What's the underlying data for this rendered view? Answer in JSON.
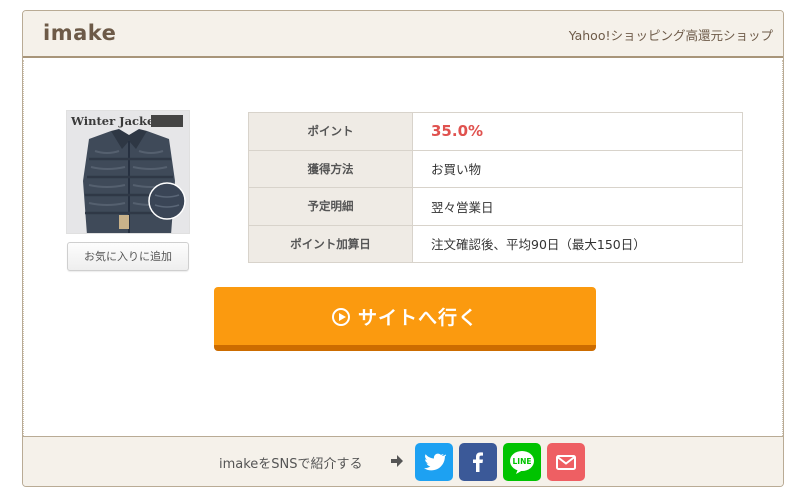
{
  "shop": {
    "name": "imake",
    "source": "Yahoo!ショッピング高還元ショップ"
  },
  "product": {
    "image_title": "Winter Jacket",
    "image_brand": "",
    "favorite_label": "お気に入りに追加"
  },
  "details": [
    {
      "key": "ポイント",
      "value": "35.0%"
    },
    {
      "key": "獲得方法",
      "value": "お買い物"
    },
    {
      "key": "予定明細",
      "value": "翌々営業日"
    },
    {
      "key": "ポイント加算日",
      "value": "注文確認後、平均90日（最大150日）"
    }
  ],
  "cta": {
    "label": "サイトへ行く",
    "icon": "play-circle-icon"
  },
  "share": {
    "text": "imakeをSNSで紹介する",
    "arrow_icon": "arrow-right-icon",
    "buttons": [
      {
        "name": "twitter",
        "icon": "twitter-icon",
        "color": "#1da1f2"
      },
      {
        "name": "facebook",
        "icon": "facebook-icon",
        "color": "#3b5998"
      },
      {
        "name": "line",
        "icon": "line-icon",
        "label": "LINE",
        "color": "#00c300"
      },
      {
        "name": "mail",
        "icon": "mail-icon",
        "color": "#ee5f63"
      }
    ]
  },
  "colors": {
    "accent": "#fb9a0f",
    "point_value": "#e0524f",
    "header_bg": "#f5f1ea"
  }
}
